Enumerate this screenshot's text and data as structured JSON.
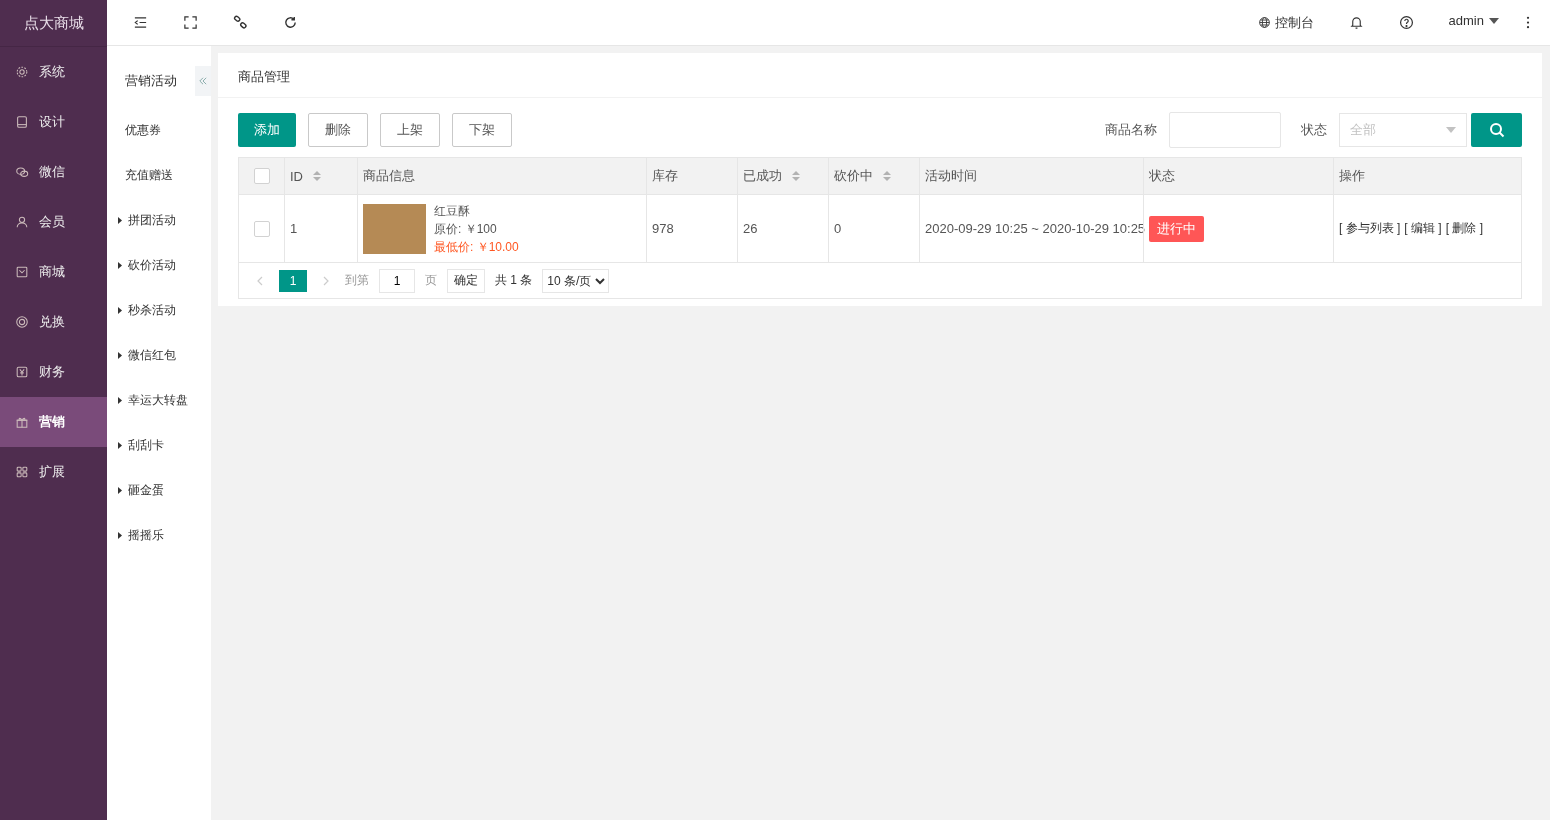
{
  "brand": "点大商城",
  "nav": [
    {
      "label": "系统",
      "selected": false
    },
    {
      "label": "设计",
      "selected": false
    },
    {
      "label": "微信",
      "selected": false
    },
    {
      "label": "会员",
      "selected": false
    },
    {
      "label": "商城",
      "selected": false
    },
    {
      "label": "兑换",
      "selected": false
    },
    {
      "label": "财务",
      "selected": false
    },
    {
      "label": "营销",
      "selected": true
    },
    {
      "label": "扩展",
      "selected": false
    }
  ],
  "submenu": {
    "title": "营销活动",
    "items": [
      {
        "label": "优惠券",
        "kind": "link"
      },
      {
        "label": "充值赠送",
        "kind": "link"
      },
      {
        "label": "拼团活动",
        "kind": "group",
        "expanded": false
      },
      {
        "label": "砍价活动",
        "kind": "group",
        "expanded": false
      },
      {
        "label": "秒杀活动",
        "kind": "group",
        "expanded": false
      },
      {
        "label": "微信红包",
        "kind": "group",
        "expanded": false
      },
      {
        "label": "幸运大转盘",
        "kind": "group",
        "expanded": false
      },
      {
        "label": "刮刮卡",
        "kind": "group",
        "expanded": false
      },
      {
        "label": "砸金蛋",
        "kind": "group",
        "expanded": false
      },
      {
        "label": "摇摇乐",
        "kind": "group",
        "expanded": false
      }
    ]
  },
  "topbar": {
    "console": "控制台",
    "user": "admin"
  },
  "page_title": "商品管理",
  "actions": [
    {
      "label": "添加",
      "kind": "primary"
    },
    {
      "label": "删除",
      "kind": "plain"
    },
    {
      "label": "上架",
      "kind": "plain"
    },
    {
      "label": "下架",
      "kind": "plain"
    }
  ],
  "filters": {
    "name_label": "商品名称",
    "status_label": "状态",
    "status_placeholder": "全部"
  },
  "table": {
    "header_checked": false,
    "columns": [
      {
        "label": "ID",
        "sortable": true
      },
      {
        "label": "商品信息",
        "sortable": false
      },
      {
        "label": "库存",
        "sortable": false
      },
      {
        "label": "已成功",
        "sortable": true
      },
      {
        "label": "砍价中",
        "sortable": true
      },
      {
        "label": "活动时间",
        "sortable": false
      },
      {
        "label": "状态",
        "sortable": false
      },
      {
        "label": "操作",
        "sortable": false
      }
    ],
    "rows": [
      {
        "checked": false,
        "id": "1",
        "name": "红豆酥",
        "original_price": "原价: ￥100",
        "lowest_price": "最低价: ￥10.00",
        "stock": "978",
        "success": "26",
        "bargaining": "0",
        "time": "2020-09-29 10:25 ~ 2020-10-29 10:25",
        "status": "进行中",
        "operations": [
          "[ 参与列表 ]",
          "[ 编辑 ]",
          "[ 删除 ]"
        ]
      }
    ]
  },
  "pagination": {
    "pages": [
      {
        "label": "1",
        "selected": true
      }
    ],
    "goto_label": "到第",
    "goto_value": "1",
    "page_unit": "页",
    "confirm": "确定",
    "total": "共 1 条",
    "page_size": "10 条/页"
  }
}
